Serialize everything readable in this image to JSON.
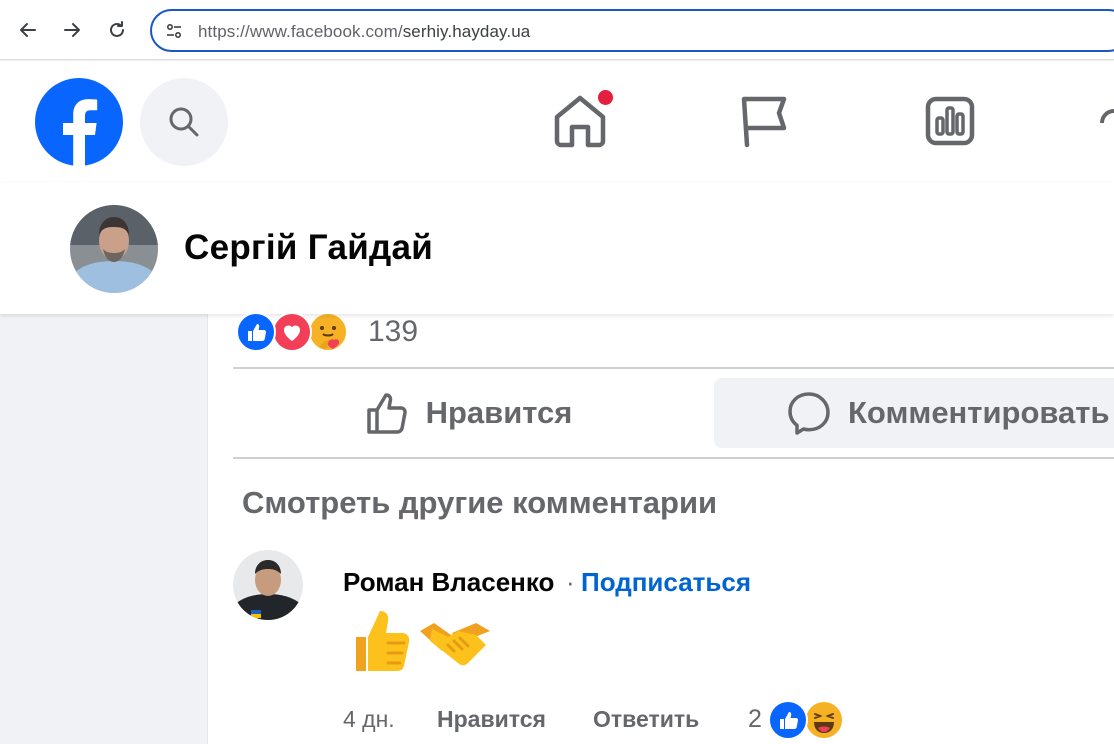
{
  "browser": {
    "url_prefix": "https://www.facebook.com/",
    "url_path": "serhiy.hayday.ua"
  },
  "header": {
    "logo": "facebook-logo",
    "icons": [
      "search-icon",
      "home-icon",
      "flag-icon",
      "chart-icon"
    ],
    "home_notification": true
  },
  "profile": {
    "name": "Сергій Гайдай"
  },
  "post": {
    "reactions": [
      "like",
      "love",
      "care"
    ],
    "reaction_count": "139",
    "like_label": "Нравится",
    "comment_label": "Комментировать",
    "more_comments": "Смотреть другие комментарии"
  },
  "comment": {
    "author": "Роман Власенко",
    "separator": "·",
    "follow": "Подписаться",
    "content_emoji": [
      "👍",
      "🤝"
    ],
    "time": "4 дн.",
    "like": "Нравится",
    "reply": "Ответить",
    "reaction_count": "2",
    "reactions": [
      "like",
      "haha"
    ]
  },
  "colors": {
    "fb_blue": "#0866ff",
    "link_blue": "#0064d1",
    "notification_red": "#e41e3f",
    "love_red": "#f33e58",
    "secondary_text": "#65676b"
  }
}
